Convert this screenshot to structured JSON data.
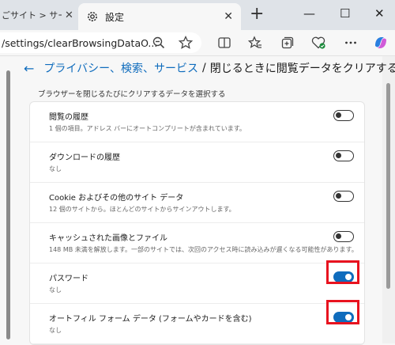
{
  "tabs": {
    "inactive_title": "ごサイト > サービス&",
    "active_title": "設定",
    "close_glyph": "✕",
    "new_tab_glyph": "+"
  },
  "window": {
    "minimize": "—",
    "maximize": "☐",
    "close": "✕"
  },
  "address_bar": {
    "url": "/settings/clearBrowsingDataO..."
  },
  "page": {
    "back_glyph": "←",
    "breadcrumb_link": "プライバシー、検索、サービス",
    "breadcrumb_separator": "/",
    "breadcrumb_current": "閉じるときに閲覧データをクリアする",
    "subtitle": "ブラウザーを閉じるたびにクリアするデータを選択する"
  },
  "options": [
    {
      "label": "閲覧の履歴",
      "desc": "1 個の項目。アドレス バーにオートコンプリートが含まれています。",
      "enabled": false
    },
    {
      "label": "ダウンロードの履歴",
      "desc": "なし",
      "enabled": false
    },
    {
      "label": "Cookie およびその他のサイト データ",
      "desc": "12 個のサイトから。ほとんどのサイトからサインアウトします。",
      "enabled": false
    },
    {
      "label": "キャッシュされた画像とファイル",
      "desc": "148 MB 未満を解放します。一部のサイトでは、次回のアクセス時に読み込みが遅くなる可能性があります。",
      "enabled": false
    },
    {
      "label": "パスワード",
      "desc": "なし",
      "enabled": true
    },
    {
      "label": "オートフィル フォーム データ (フォームやカードを含む)",
      "desc": "なし",
      "enabled": true
    }
  ],
  "colors": {
    "accent": "#0f6cbd",
    "highlight": "#e8131f"
  }
}
